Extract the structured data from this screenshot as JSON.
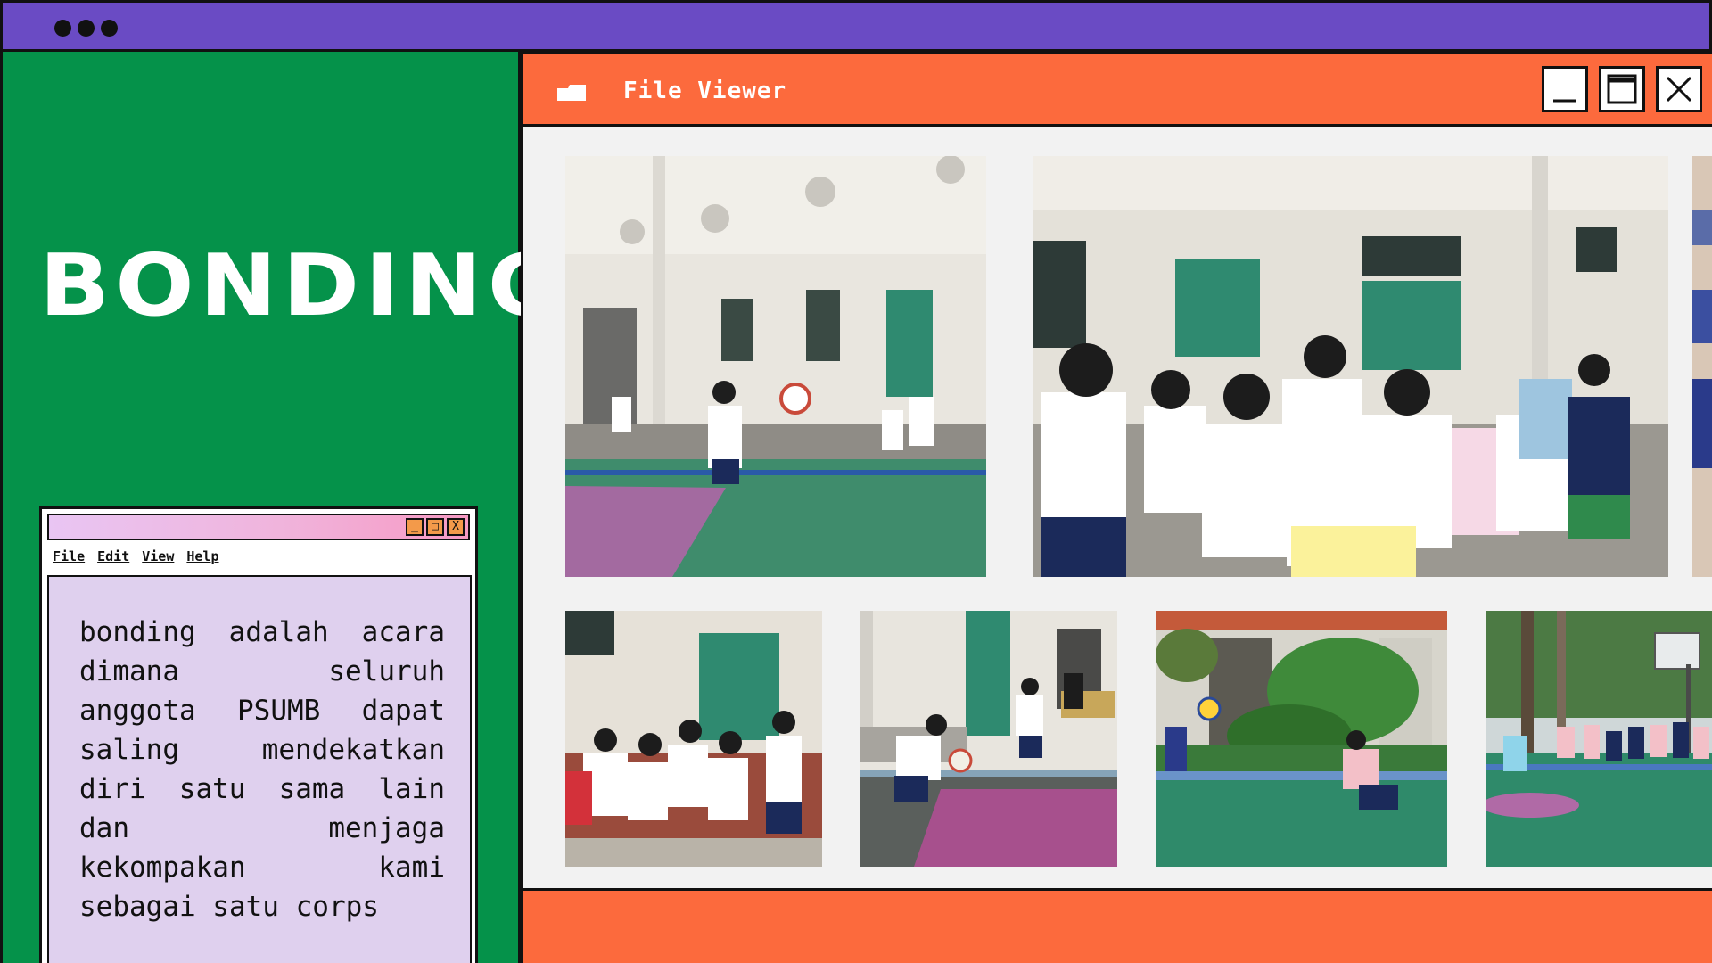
{
  "topbar": {
    "dots": 3
  },
  "left_panel": {
    "title": "BONDING"
  },
  "notepad": {
    "menu": [
      "File",
      "Edit",
      "View",
      "Help"
    ],
    "controls": [
      "_",
      "□",
      "X"
    ],
    "text": "bonding adalah acara dimana seluruh anggota PSUMB dapat saling mendekatkan diri satu sama lain dan menjaga kekompakan kami sebagai satu corps"
  },
  "file_viewer": {
    "title": "File Viewer",
    "icon": "folder-icon",
    "controls": [
      "minimize-icon",
      "maximize-icon",
      "close-icon"
    ],
    "photos": [
      "volleyball-serve-photo",
      "group-crowd-photo",
      "edge-partial-photo",
      "cheering-group-photo",
      "bump-pass-photo",
      "garden-court-photo",
      "basketball-court-photo"
    ]
  },
  "colors": {
    "green": "#05924a",
    "purple": "#6a4bc4",
    "orange": "#fc6a3d",
    "lavender": "#dfd0ee"
  }
}
